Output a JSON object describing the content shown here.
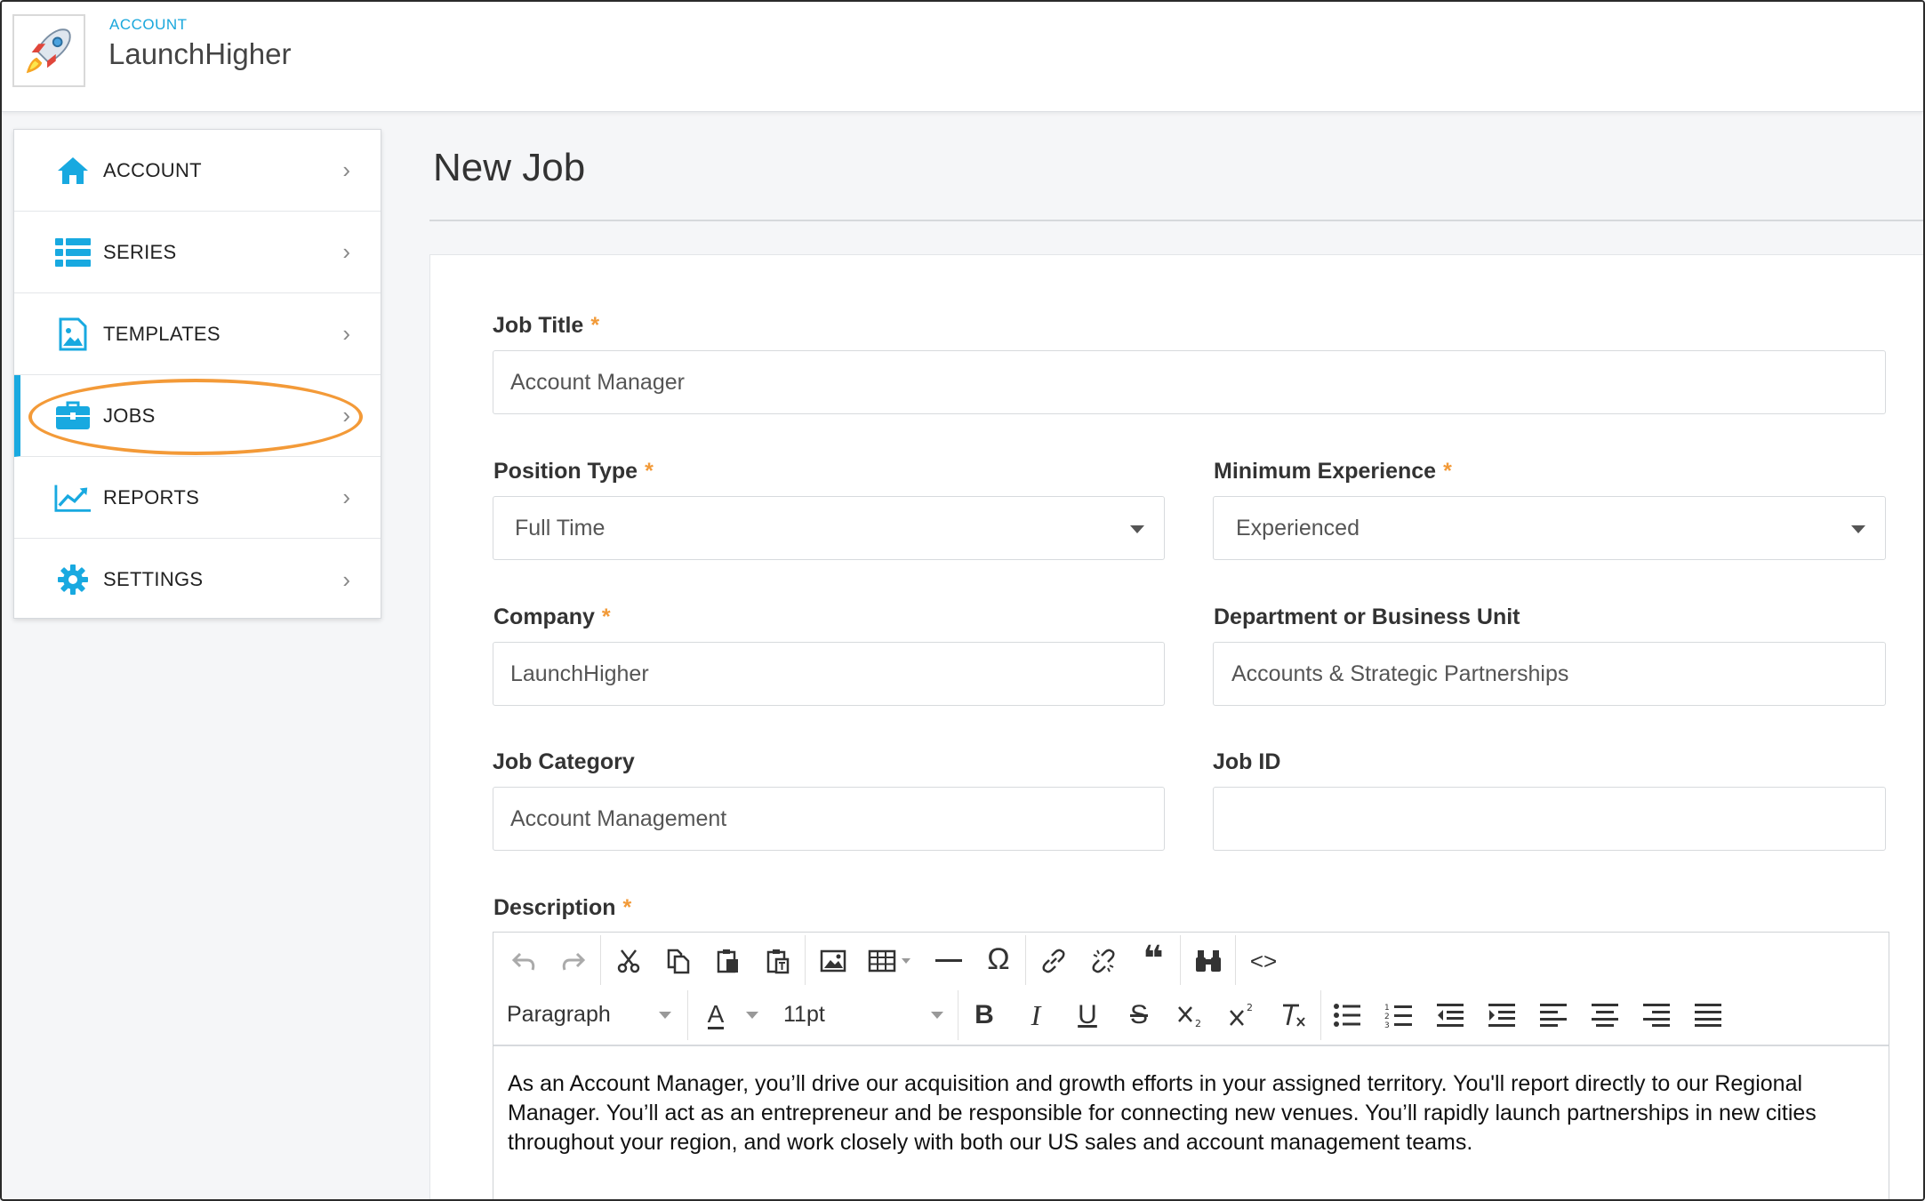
{
  "header": {
    "account_label": "ACCOUNT",
    "account_name": "LaunchHigher"
  },
  "sidebar": {
    "items": [
      {
        "label": "ACCOUNT",
        "icon": "home-icon"
      },
      {
        "label": "SERIES",
        "icon": "list-icon"
      },
      {
        "label": "TEMPLATES",
        "icon": "image-file-icon"
      },
      {
        "label": "JOBS",
        "icon": "briefcase-icon",
        "active": true
      },
      {
        "label": "REPORTS",
        "icon": "chart-line-icon"
      },
      {
        "label": "SETTINGS",
        "icon": "gear-icon"
      }
    ],
    "chevron": "›"
  },
  "main": {
    "title": "New Job",
    "required_mark": "*",
    "fields": {
      "job_title": {
        "label": "Job Title",
        "value": "Account Manager"
      },
      "position_type": {
        "label": "Position Type",
        "value": "Full Time"
      },
      "minimum_experience": {
        "label": "Minimum Experience",
        "value": "Experienced"
      },
      "company": {
        "label": "Company",
        "value": "LaunchHigher"
      },
      "department": {
        "label": "Department or Business Unit",
        "value": "Accounts & Strategic Partnerships"
      },
      "job_category": {
        "label": "Job Category",
        "value": "Account Management"
      },
      "job_id": {
        "label": "Job ID",
        "value": ""
      },
      "description": {
        "label": "Description",
        "value": "As an Account Manager, you’ll drive our acquisition and growth efforts in your assigned territory. You'll report directly to our Regional Manager. You’ll act as an entrepreneur and be responsible for connecting new venues. You’ll rapidly launch partnerships in new cities throughout your region, and work closely with both our US sales and account management teams."
      }
    },
    "editor": {
      "block_format": "Paragraph",
      "font_size": "11pt",
      "font_color_glyph": "A",
      "bold_glyph": "B",
      "italic_glyph": "I",
      "underline_glyph": "U",
      "strike_glyph": "S",
      "omega_glyph": "Ω",
      "quote_glyph": "❝",
      "code_glyph": "<>"
    }
  },
  "colors": {
    "accent": "#18a9e0",
    "required": "#f29a38",
    "highlight_ring": "#f39a38"
  }
}
